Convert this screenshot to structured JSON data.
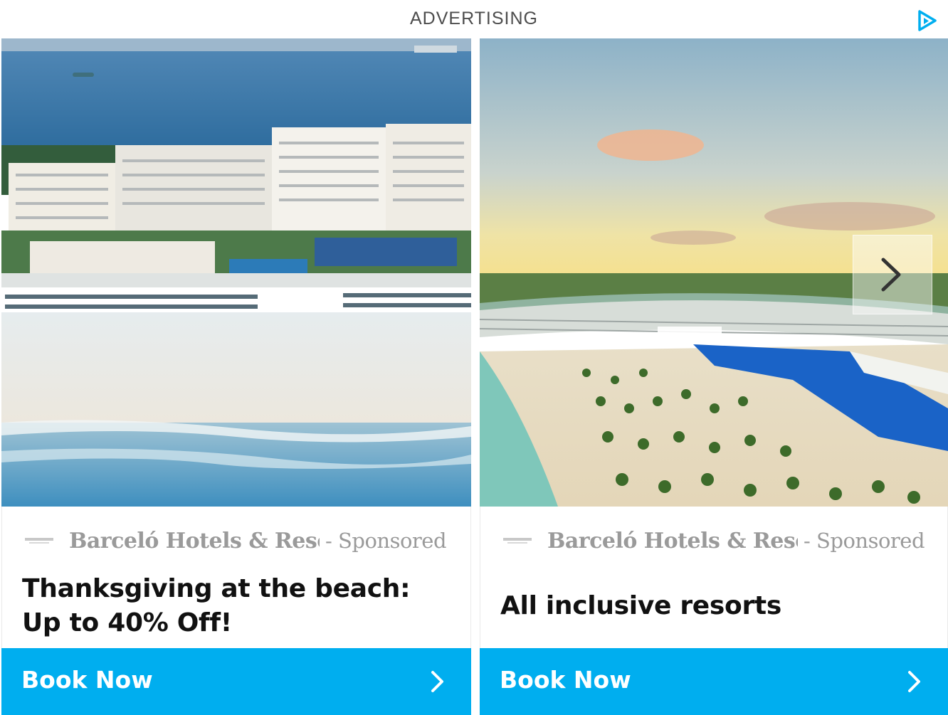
{
  "header": {
    "label": "ADVERTISING",
    "adchoices_icon": "adchoices-icon"
  },
  "cards": [
    {
      "image_icon": "resort-photo-cancun",
      "brand": "Barceló Hotels & Resort",
      "sponsored": "- Sponsored",
      "headline": "Thanksgiving at the beach: Up to 40% Off!",
      "cta": "Book Now"
    },
    {
      "image_icon": "resort-photo-riviera",
      "brand": "Barceló Hotels & Resort",
      "sponsored": "- Sponsored",
      "headline": "All inclusive resorts",
      "cta": "Book Now"
    }
  ],
  "carousel": {
    "next_icon": "chevron-right-icon"
  },
  "colors": {
    "cta": "#00aeef",
    "brand_text": "#9a9a9a",
    "headline": "#111111",
    "header_text": "#4d4d4d"
  }
}
